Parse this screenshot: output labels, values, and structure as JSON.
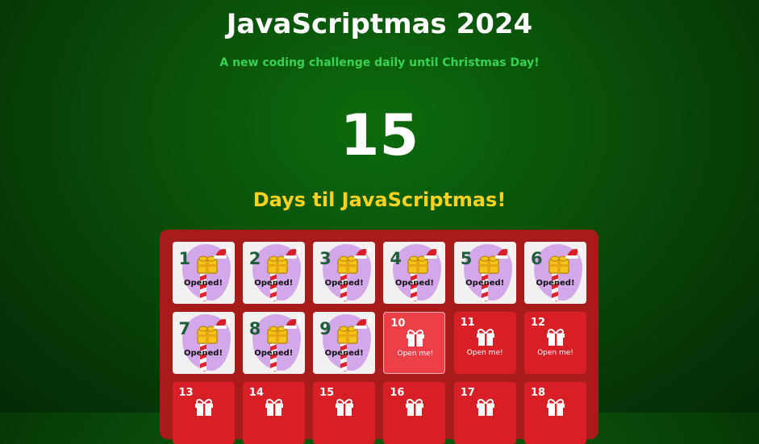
{
  "header": {
    "title": "JavaScriptmas 2024",
    "subtitle": "A new coding challenge daily until Christmas Day!"
  },
  "countdown": {
    "value": "15",
    "label": "Days til JavaScriptmas!"
  },
  "colors": {
    "background": "#0a4d0a",
    "title": "#ffffff",
    "subtitle": "#39d353",
    "days_label": "#ffd21f",
    "calendar": "#a81b1b",
    "door_closed": "#d81f26",
    "door_opened": "#f3f0f0"
  },
  "doors": [
    {
      "day": "1",
      "state": "opened",
      "label": "Opened!"
    },
    {
      "day": "2",
      "state": "opened",
      "label": "Opened!"
    },
    {
      "day": "3",
      "state": "opened",
      "label": "Opened!"
    },
    {
      "day": "4",
      "state": "opened",
      "label": "Opened!"
    },
    {
      "day": "5",
      "state": "opened",
      "label": "Opened!"
    },
    {
      "day": "6",
      "state": "opened",
      "label": "Opened!"
    },
    {
      "day": "7",
      "state": "opened",
      "label": "Opened!"
    },
    {
      "day": "8",
      "state": "opened",
      "label": "Opened!"
    },
    {
      "day": "9",
      "state": "opened",
      "label": "Opened!"
    },
    {
      "day": "10",
      "state": "hover",
      "label": "Open me!",
      "icon": "gift-icon"
    },
    {
      "day": "11",
      "state": "closed",
      "label": "Open me!",
      "icon": "gift-icon"
    },
    {
      "day": "12",
      "state": "closed",
      "label": "Open me!",
      "icon": "gift-icon"
    },
    {
      "day": "13",
      "state": "closed",
      "label": "",
      "icon": "gift-icon"
    },
    {
      "day": "14",
      "state": "closed",
      "label": "",
      "icon": "gift-icon"
    },
    {
      "day": "15",
      "state": "closed",
      "label": "",
      "icon": "gift-icon"
    },
    {
      "day": "16",
      "state": "closed",
      "label": "",
      "icon": "gift-icon"
    },
    {
      "day": "17",
      "state": "closed",
      "label": "",
      "icon": "gift-icon"
    },
    {
      "day": "18",
      "state": "closed",
      "label": "",
      "icon": "gift-icon"
    }
  ]
}
